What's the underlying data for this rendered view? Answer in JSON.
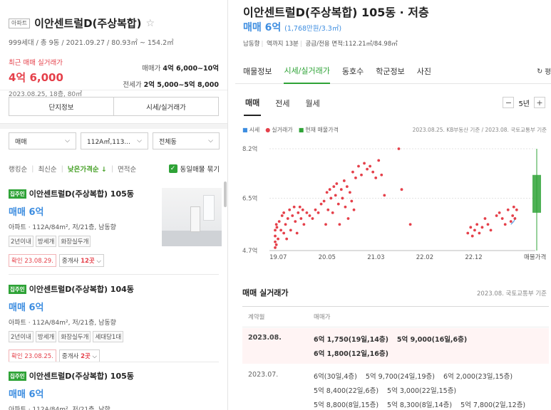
{
  "left": {
    "type_tag": "아파트",
    "complex_name": "이안센트럴D(주상복합)",
    "star_icon": "☆",
    "sub_info": "999세대 / 총 9동 / 2021.09.27 / 80.93㎡ ~ 154.2㎡",
    "recent_label": "최근 매매 실거래가",
    "recent_price": "4억 6,000",
    "recent_date": "2023.08.25, 18층, 80㎡",
    "sale_label": "매매가",
    "sale_range": "4억 6,000~10억",
    "jeonse_label": "전세가",
    "jeonse_range": "2억 5,000~5억 8,000",
    "buttons": [
      "단지정보",
      "시세/실거래가"
    ],
    "filters": {
      "deal": "매매",
      "area": "112A㎡,113...",
      "dong": "전체동"
    },
    "sort": [
      "랭킹순",
      "최신순",
      "낮은가격순 ↓",
      "면적순"
    ],
    "same_listing_label": "동일매물 묶기",
    "listings": [
      {
        "badge": "집주인",
        "title": "이안센트럴D(주상복합) 105동",
        "price": "매매 6억",
        "desc": "아파트 · 112A/84m², 저/21층, 남동향",
        "tags": [
          "2년이내",
          "방세개",
          "화장실두개"
        ],
        "confirm": "확인 23.08.29.",
        "agent_prefix": "중개사 ",
        "agent_count": "12곳"
      },
      {
        "badge": "집주인",
        "title": "이안센트럴D(주상복합) 104동",
        "price": "매매 6억",
        "desc": "아파트 · 112A/84m², 저/21층, 남동향",
        "tags": [
          "2년이내",
          "방세개",
          "화장실두개",
          "세대당1대"
        ],
        "confirm": "확인 23.08.25.",
        "agent_prefix": "중개사 ",
        "agent_count": "2곳"
      },
      {
        "badge": "집주인",
        "title": "이안센트럴D(주상복합) 105동",
        "price": "매매 6억",
        "desc": "아파트 · 112A/84m², 저/21층, 남향"
      }
    ]
  },
  "right": {
    "title": "이안센트럴D(주상복합) 105동 · 저층",
    "price": "매매 6억",
    "price_per": "(1,768만원/3.3㎡)",
    "meta": [
      "남동향",
      "역까지 13분",
      "공급/전용 면적:112.21㎡/84.98㎡"
    ],
    "tabs": [
      "매물정보",
      "시세/실거래가",
      "동호수",
      "학군정보",
      "사진"
    ],
    "active_tab": 1,
    "refresh_label": "평",
    "subtabs": [
      "매매",
      "전세",
      "월세"
    ],
    "period": "5년",
    "legend": [
      "시세",
      "실거래가",
      "현재 매물가격"
    ],
    "legend_src": "2023.08.25. KB부동산 기준 / 2023.08. 국토교통부 기준",
    "deals_title": "매매 실거래가",
    "deals_src": "2023.08. 국토교통부 기준",
    "deals_header": [
      "계약월",
      "매매가"
    ],
    "deals": [
      {
        "month": "2023.08.",
        "lines": [
          [
            "6억 1,750(19일,14층)",
            "5억 9,000(16일,6층)"
          ],
          [
            "6억 1,800(12일,16층)"
          ]
        ]
      },
      {
        "month": "2023.07.",
        "lines": [
          [
            "6억(30일,4층)",
            "5억 9,700(24일,19층)",
            "6억 2,000(23일,15층)"
          ],
          [
            "5억 8,400(22일,6층)",
            "5억 3,000(22일,15층)"
          ],
          [
            "5억 8,800(8일,15층)",
            "5억 8,300(8일,14층)",
            "5억 7,800(2일,12층)"
          ]
        ]
      }
    ]
  },
  "chart_data": {
    "type": "scatter",
    "x_tick_labels": [
      "19.07",
      "20.05",
      "21.03",
      "22.02",
      "22.12",
      "매물가격"
    ],
    "y_tick_labels": [
      "8.2억",
      "6.5억",
      "4.7억"
    ],
    "ylim": [
      4.7,
      8.2
    ],
    "xlim": [
      2019.4,
      2023.9
    ],
    "grid": true,
    "series": [
      {
        "name": "실거래가",
        "color": "#e5404a",
        "points": [
          [
            2019.45,
            4.8
          ],
          [
            2019.45,
            5.0
          ],
          [
            2019.45,
            5.2
          ],
          [
            2019.45,
            5.4
          ],
          [
            2019.47,
            4.9
          ],
          [
            2019.47,
            5.6
          ],
          [
            2019.48,
            5.5
          ],
          [
            2019.5,
            5.1
          ],
          [
            2019.52,
            5.7
          ],
          [
            2019.55,
            5.4
          ],
          [
            2019.57,
            5.9
          ],
          [
            2019.6,
            5.3
          ],
          [
            2019.6,
            6.0
          ],
          [
            2019.63,
            5.6
          ],
          [
            2019.65,
            5.1
          ],
          [
            2019.67,
            5.8
          ],
          [
            2019.7,
            6.1
          ],
          [
            2019.72,
            5.4
          ],
          [
            2019.75,
            5.9
          ],
          [
            2019.78,
            6.2
          ],
          [
            2019.8,
            5.7
          ],
          [
            2019.83,
            5.3
          ],
          [
            2019.85,
            6.0
          ],
          [
            2019.88,
            6.2
          ],
          [
            2019.9,
            5.8
          ],
          [
            2019.93,
            6.1
          ],
          [
            2019.95,
            5.6
          ],
          [
            2020.0,
            6.0
          ],
          [
            2020.05,
            5.9
          ],
          [
            2020.1,
            5.8
          ],
          [
            2020.15,
            6.1
          ],
          [
            2020.2,
            6.0
          ],
          [
            2020.25,
            6.3
          ],
          [
            2020.3,
            6.4
          ],
          [
            2020.33,
            5.6
          ],
          [
            2020.35,
            6.7
          ],
          [
            2020.37,
            6.1
          ],
          [
            2020.4,
            6.8
          ],
          [
            2020.42,
            6.5
          ],
          [
            2020.45,
            6.0
          ],
          [
            2020.47,
            6.9
          ],
          [
            2020.5,
            6.6
          ],
          [
            2020.52,
            7.0
          ],
          [
            2020.55,
            6.3
          ],
          [
            2020.57,
            5.6
          ],
          [
            2020.6,
            6.8
          ],
          [
            2020.62,
            6.5
          ],
          [
            2020.65,
            7.1
          ],
          [
            2020.67,
            6.2
          ],
          [
            2020.7,
            6.9
          ],
          [
            2020.72,
            5.8
          ],
          [
            2020.75,
            6.7
          ],
          [
            2020.78,
            6.4
          ],
          [
            2020.8,
            7.4
          ],
          [
            2020.82,
            6.1
          ],
          [
            2020.85,
            7.2
          ],
          [
            2020.9,
            7.6
          ],
          [
            2020.95,
            7.3
          ],
          [
            2021.0,
            7.7
          ],
          [
            2021.05,
            7.5
          ],
          [
            2021.1,
            7.6
          ],
          [
            2021.15,
            7.4
          ],
          [
            2021.2,
            7.2
          ],
          [
            2021.25,
            7.8
          ],
          [
            2021.3,
            7.3
          ],
          [
            2021.35,
            6.6
          ],
          [
            2021.6,
            8.2
          ],
          [
            2021.65,
            6.8
          ],
          [
            2021.8,
            5.6
          ],
          [
            2022.8,
            5.3
          ],
          [
            2022.85,
            5.5
          ],
          [
            2022.88,
            5.2
          ],
          [
            2022.92,
            5.4
          ],
          [
            2022.96,
            5.6
          ],
          [
            2023.0,
            5.3
          ],
          [
            2023.05,
            5.5
          ],
          [
            2023.1,
            5.8
          ],
          [
            2023.15,
            5.6
          ],
          [
            2023.2,
            5.4
          ],
          [
            2023.3,
            5.9
          ],
          [
            2023.35,
            6.0
          ],
          [
            2023.4,
            5.8
          ],
          [
            2023.45,
            5.6
          ],
          [
            2023.5,
            6.1
          ],
          [
            2023.55,
            5.7
          ],
          [
            2023.58,
            5.9
          ],
          [
            2023.6,
            6.2
          ],
          [
            2023.62,
            5.8
          ],
          [
            2023.65,
            6.1
          ]
        ]
      },
      {
        "name": "시세",
        "color": "#3d8de0",
        "points": [
          [
            2023.55,
            5.6
          ],
          [
            2023.6,
            5.7
          ],
          [
            2023.63,
            5.85
          ]
        ]
      },
      {
        "name": "현재 매물가격",
        "color": "#2fa337",
        "range": [
          6.0,
          7.3
        ],
        "line_top": 8.2
      }
    ]
  }
}
